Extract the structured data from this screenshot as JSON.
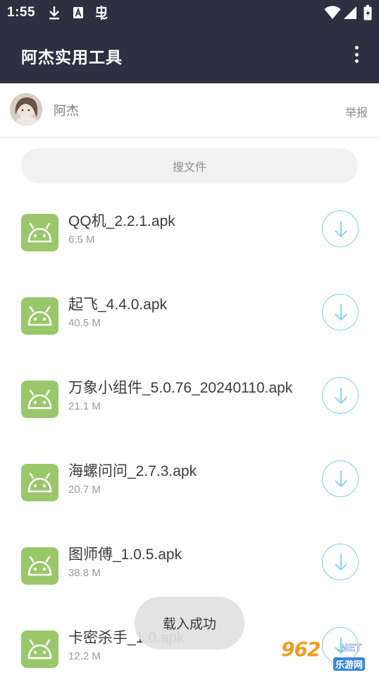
{
  "status_bar": {
    "time": "1:55",
    "icons": [
      "download-icon",
      "a-icon",
      "bug-icon",
      "wifi-icon",
      "signal-icon",
      "battery-icon"
    ]
  },
  "app_bar": {
    "title": "阿杰实用工具",
    "menu_icon": "more-vert-icon",
    "background": "#2e3041"
  },
  "user": {
    "name": "阿杰",
    "report_label": "举报"
  },
  "search": {
    "placeholder": "搜文件"
  },
  "files": [
    {
      "name": "QQ机_2.2.1.apk",
      "size": "6.5 M"
    },
    {
      "name": "起飞_4.4.0.apk",
      "size": "40.5 M"
    },
    {
      "name": "万象小组件_5.0.76_20240110.apk",
      "size": "21.1 M"
    },
    {
      "name": "海螺问问_2.7.3.apk",
      "size": "20.7 M"
    },
    {
      "name": "图师傅_1.0.5.apk",
      "size": "38.8 M"
    },
    {
      "name": "卡密杀手_1.0.apk",
      "size": "12.2 M"
    }
  ],
  "toast": {
    "message": "载入成功"
  },
  "watermark": {
    "number": "962",
    "suffix": ".NET",
    "site": "乐游网"
  },
  "colors": {
    "apk_icon": "#99c76a",
    "download_ring": "#7fd0ec",
    "watermark_orange": "#f29a24",
    "watermark_blue": "#3a86d6"
  }
}
